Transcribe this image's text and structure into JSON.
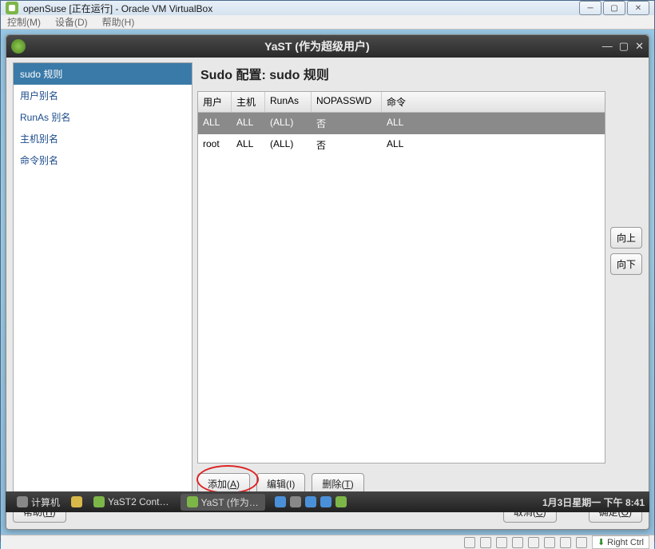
{
  "win7": {
    "title": "openSuse [正在运行] - Oracle VM VirtualBox",
    "minimize": "─",
    "maximize": "▢",
    "close": "✕"
  },
  "vbox_menu": {
    "control": "控制(M)",
    "device": "设备(D)",
    "help": "帮助(H)"
  },
  "yast": {
    "title": "YaST (作为超级用户)",
    "minimize": "—",
    "maximize": "▢",
    "close": "✕"
  },
  "sidebar": {
    "items": [
      {
        "label": "sudo 规则",
        "selected": true
      },
      {
        "label": "用户别名",
        "selected": false
      },
      {
        "label": "RunAs 别名",
        "selected": false
      },
      {
        "label": "主机别名",
        "selected": false
      },
      {
        "label": "命令别名",
        "selected": false
      }
    ]
  },
  "content": {
    "heading": "Sudo 配置: sudo 规则",
    "columns": {
      "user": "用户",
      "host": "主机",
      "runas": "RunAs",
      "nopasswd": "NOPASSWD",
      "cmd": "命令"
    },
    "rows": [
      {
        "user": "ALL",
        "host": "ALL",
        "runas": "(ALL)",
        "nopasswd": "否",
        "cmd": "ALL",
        "selected": true
      },
      {
        "user": "root",
        "host": "ALL",
        "runas": "(ALL)",
        "nopasswd": "否",
        "cmd": "ALL",
        "selected": false
      }
    ],
    "up_btn": "向上",
    "down_btn": "向下",
    "add_btn_pre": "添加(",
    "add_btn_u": "A",
    "add_btn_post": ")",
    "edit_btn": "编辑(I)",
    "delete_btn_pre": "删除(",
    "delete_btn_u": "T",
    "delete_btn_post": ")"
  },
  "footer": {
    "help_pre": "帮助(",
    "help_u": "H",
    "help_post": ")",
    "cancel_pre": "取消(",
    "cancel_u": "C",
    "cancel_post": ")",
    "ok_pre": "确定(",
    "ok_u": "O",
    "ok_post": ")"
  },
  "taskbar": {
    "computer": "计算机",
    "app1": "YaST2 Cont…",
    "app2": "YaST (作为…",
    "clock": "1月3日星期一 下午  8:41"
  },
  "vbox_status": {
    "right_ctrl": "Right Ctrl"
  }
}
